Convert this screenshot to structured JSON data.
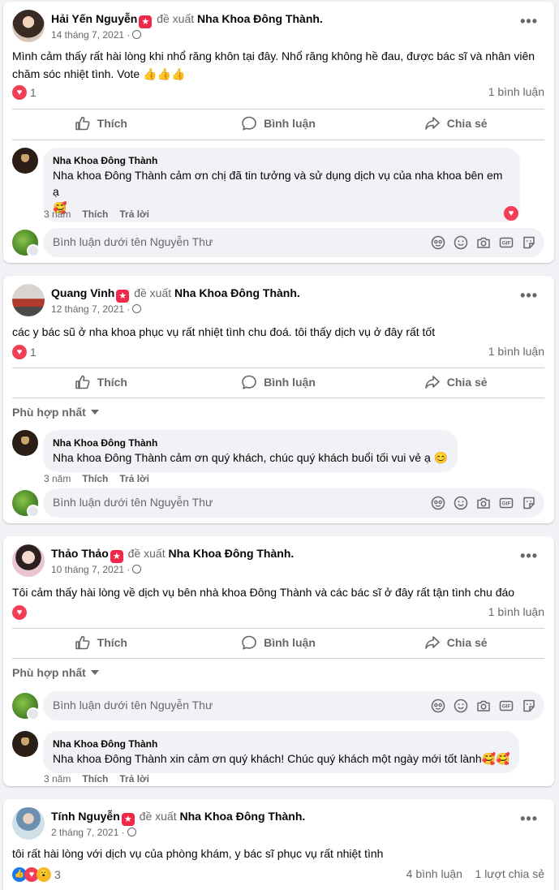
{
  "common": {
    "recommends": "đề xuất",
    "page_name": "Nha Khoa Đông Thành.",
    "like": "Thích",
    "comment": "Bình luận",
    "share": "Chia sẻ",
    "reply": "Trả lời",
    "composer_placeholder": "Bình luận dưới tên Nguyễn Thư",
    "sort_label": "Phù hợp nhất",
    "more": "•••",
    "dentist": "Nha Khoa Đông Thành"
  },
  "posts": [
    {
      "author": "Hải Yến Nguyễn",
      "date": "14 tháng 7, 2021 ·",
      "text": "Mình cảm thấy rất hài lòng khi nhổ răng khôn tại đây. Nhổ răng không hề đau, được bác sĩ và nhân viên chăm sóc nhiệt tình. Vote 👍👍👍",
      "reaction_count": "1",
      "comment_count": "1 bình luận",
      "reply": {
        "text": "Nha khoa Đông Thành cảm ơn chị đã tin tưởng và sử dụng dịch vụ của nha khoa bên em ạ",
        "emoji": "🥰",
        "time": "3 năm"
      }
    },
    {
      "author": "Quang Vinh",
      "date": "12 tháng 7, 2021 ·",
      "text": "các y bác sũ ở nha khoa phục vụ rất nhiệt tình chu đoá. tôi thấy dịch vụ ở đây rất tốt",
      "reaction_count": "1",
      "comment_count": "1 bình luận",
      "reply": {
        "text": "Nha khoa Đông Thành cảm ơn quý khách, chúc quý khách buổi tối vui vẻ ạ 😊",
        "time": "3 năm"
      }
    },
    {
      "author": "Thảo Thảo",
      "date": "10 tháng 7, 2021 ·",
      "text": "Tôi cảm thấy hài lòng về dịch vụ bên nhà khoa Đông Thành và các bác sĩ ở đây rất tận tình chu đáo",
      "comment_count": "1 bình luận",
      "reply": {
        "text": "Nha khoa Đông Thành xin cảm ơn quý khách! Chúc quý khách một ngày mới tốt lành🥰🥰",
        "time": "3 năm"
      }
    },
    {
      "author": "Tính Nguyễn",
      "date": "2 tháng 7, 2021 ·",
      "text": "tôi rất hài lòng với dịch vụ của phòng khám, y bác sĩ phục vụ rất nhiệt tình",
      "reaction_count": "3",
      "comment_count": "4 bình luận",
      "share_count": "1 lượt chia sẻ"
    }
  ]
}
